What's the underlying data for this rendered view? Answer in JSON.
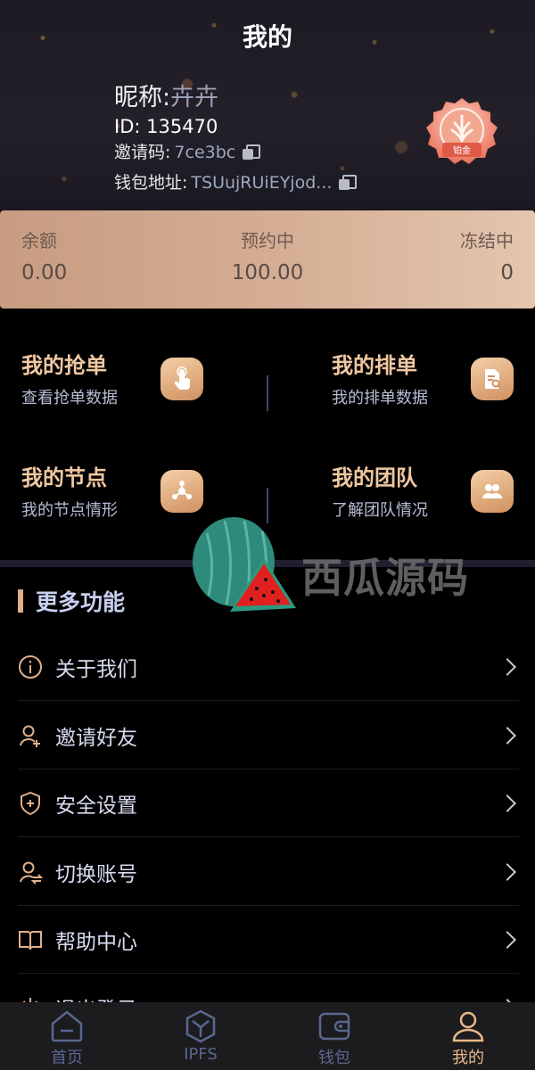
{
  "header": {
    "title": "我的",
    "nickname_label": "昵称:",
    "nickname": "卉卉",
    "id_label": "ID:",
    "id_value": "135470",
    "invite_label": "邀请码:",
    "invite_code": "7ce3bc",
    "wallet_label": "钱包地址:",
    "wallet_address": "TSUujRUiEYjod...",
    "badge_text": "铂金"
  },
  "balance": {
    "items": [
      {
        "label": "余额",
        "value": "0.00"
      },
      {
        "label": "预约中",
        "value": "100.00"
      },
      {
        "label": "冻结中",
        "value": "0"
      }
    ]
  },
  "grid": [
    {
      "title": "我的抢单",
      "subtitle": "查看抢单数据",
      "icon": "tap-hand-icon"
    },
    {
      "title": "我的排单",
      "subtitle": "我的排单数据",
      "icon": "document-search-icon"
    },
    {
      "title": "我的节点",
      "subtitle": "我的节点情形",
      "icon": "node-network-icon"
    },
    {
      "title": "我的团队",
      "subtitle": "了解团队情况",
      "icon": "team-icon"
    }
  ],
  "watermark": {
    "text": "西瓜源码"
  },
  "more": {
    "title": "更多功能",
    "items": [
      {
        "label": "关于我们",
        "icon": "info-icon"
      },
      {
        "label": "邀请好友",
        "icon": "add-user-icon"
      },
      {
        "label": "安全设置",
        "icon": "shield-icon"
      },
      {
        "label": "切换账号",
        "icon": "switch-user-icon"
      },
      {
        "label": "帮助中心",
        "icon": "book-icon"
      },
      {
        "label": "退出登录",
        "icon": "power-icon"
      }
    ]
  },
  "tabbar": {
    "items": [
      {
        "label": "首页",
        "icon": "home-icon",
        "active": false
      },
      {
        "label": "IPFS",
        "icon": "ipfs-icon",
        "active": false
      },
      {
        "label": "钱包",
        "icon": "wallet-icon",
        "active": false
      },
      {
        "label": "我的",
        "icon": "profile-icon",
        "active": true
      }
    ]
  },
  "colors": {
    "accent": "#e8b888",
    "tab_inactive": "#5a6690",
    "card_gradient_start": "#c89c80",
    "card_gradient_end": "#e4c5ae"
  }
}
